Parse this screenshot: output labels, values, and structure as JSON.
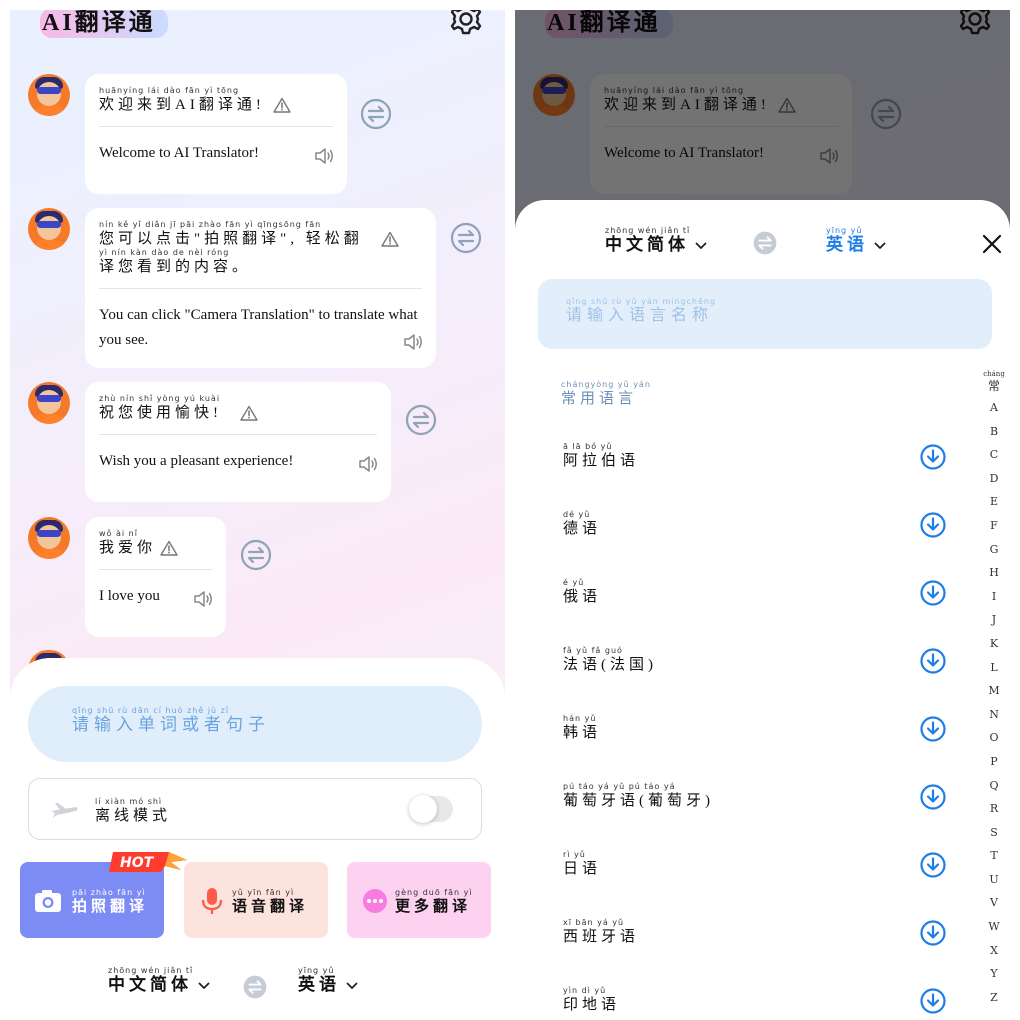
{
  "app": {
    "title": "AI翻译通"
  },
  "colors": {
    "accent": "#3b8ee8",
    "camera_btn": "#7d8cf5",
    "voice_btn": "#fde3de",
    "more_btn": "#fdd2f0",
    "hot": "#ff3b2e"
  },
  "icons": {
    "settings": "gear-icon",
    "swap": "swap-arrows-icon",
    "warning": "warning-triangle-icon",
    "speaker": "speaker-icon",
    "download": "download-circle-icon",
    "close": "close-icon",
    "plane": "airplane-icon",
    "camera": "camera-icon",
    "mic": "microphone-icon",
    "more": "more-dots-icon"
  },
  "chat": [
    {
      "zh": "欢迎来到AI翻译通!",
      "py": "huānyíng lái dào   fān yì tōng",
      "en": "Welcome to AI Translator!"
    },
    {
      "zh": "您可以点击\"拍照翻译\", 轻松翻译您看到的内容。",
      "py": "nín kě yǐ diǎn jī  pāi zhào fān yì   qīngsōng fān",
      "py2": "yì nín kàn dào de nèi róng",
      "zh1": "您可以点击\"拍照翻译\", 轻松翻",
      "zh2": "译您看到的内容。",
      "en": "You can click \"Camera Translation\" to translate what you see."
    },
    {
      "zh": "祝您使用愉快!",
      "py": "zhù nín shǐ yòng yú kuài",
      "en": "Wish you a pleasant experience!"
    },
    {
      "zh": "我爱你",
      "py": "wǒ ài nǐ",
      "en": "I love you"
    }
  ],
  "input": {
    "placeholder_zh": "请输入单词或者句子",
    "placeholder_py": "qǐng shū rù dān cí huò zhě jù zǐ"
  },
  "offline": {
    "label_zh": "离线模式",
    "label_py": "lí xiàn mó shì",
    "enabled": false
  },
  "features": [
    {
      "zh": "拍照翻译",
      "py": "pāi zhào fān yì",
      "badge": "HOT"
    },
    {
      "zh": "语音翻译",
      "py": "yǔ yīn fān yì"
    },
    {
      "zh": "更多翻译",
      "py": "gèng duō fān yì"
    }
  ],
  "languages": {
    "source": {
      "zh": "中文简体",
      "py": "zhōng wén jiǎn tǐ"
    },
    "target": {
      "zh": "英语",
      "py": "yīng yǔ"
    }
  },
  "picker": {
    "search_placeholder_zh": "请输入语言名称",
    "search_placeholder_py": "qǐng shū rù yǔ yán míngchēng",
    "section_zh": "常用语言",
    "section_py": "chángyòng yǔ yán",
    "items": [
      {
        "zh": "阿拉伯语",
        "py": "ā lā bó yǔ"
      },
      {
        "zh": "德语",
        "py": "dé yǔ"
      },
      {
        "zh": "俄语",
        "py": "é yǔ"
      },
      {
        "zh": "法语(法国)",
        "py": "fǎ yǔ  fǎ guó"
      },
      {
        "zh": "韩语",
        "py": "hán yǔ"
      },
      {
        "zh": "葡萄牙语(葡萄牙)",
        "py": "pú táo yá yǔ    pú táo yá"
      },
      {
        "zh": "日语",
        "py": "rì yǔ"
      },
      {
        "zh": "西班牙语",
        "py": "xī bān yá yǔ"
      },
      {
        "zh": "印地语",
        "py": "yìn dì yǔ"
      }
    ],
    "index_first_zh": "常",
    "index_first_py": "cháng",
    "index": [
      "A",
      "B",
      "C",
      "D",
      "E",
      "F",
      "G",
      "H",
      "I",
      "J",
      "K",
      "L",
      "M",
      "N",
      "O",
      "P",
      "Q",
      "R",
      "S",
      "T",
      "U",
      "V",
      "W",
      "X",
      "Y",
      "Z"
    ]
  }
}
